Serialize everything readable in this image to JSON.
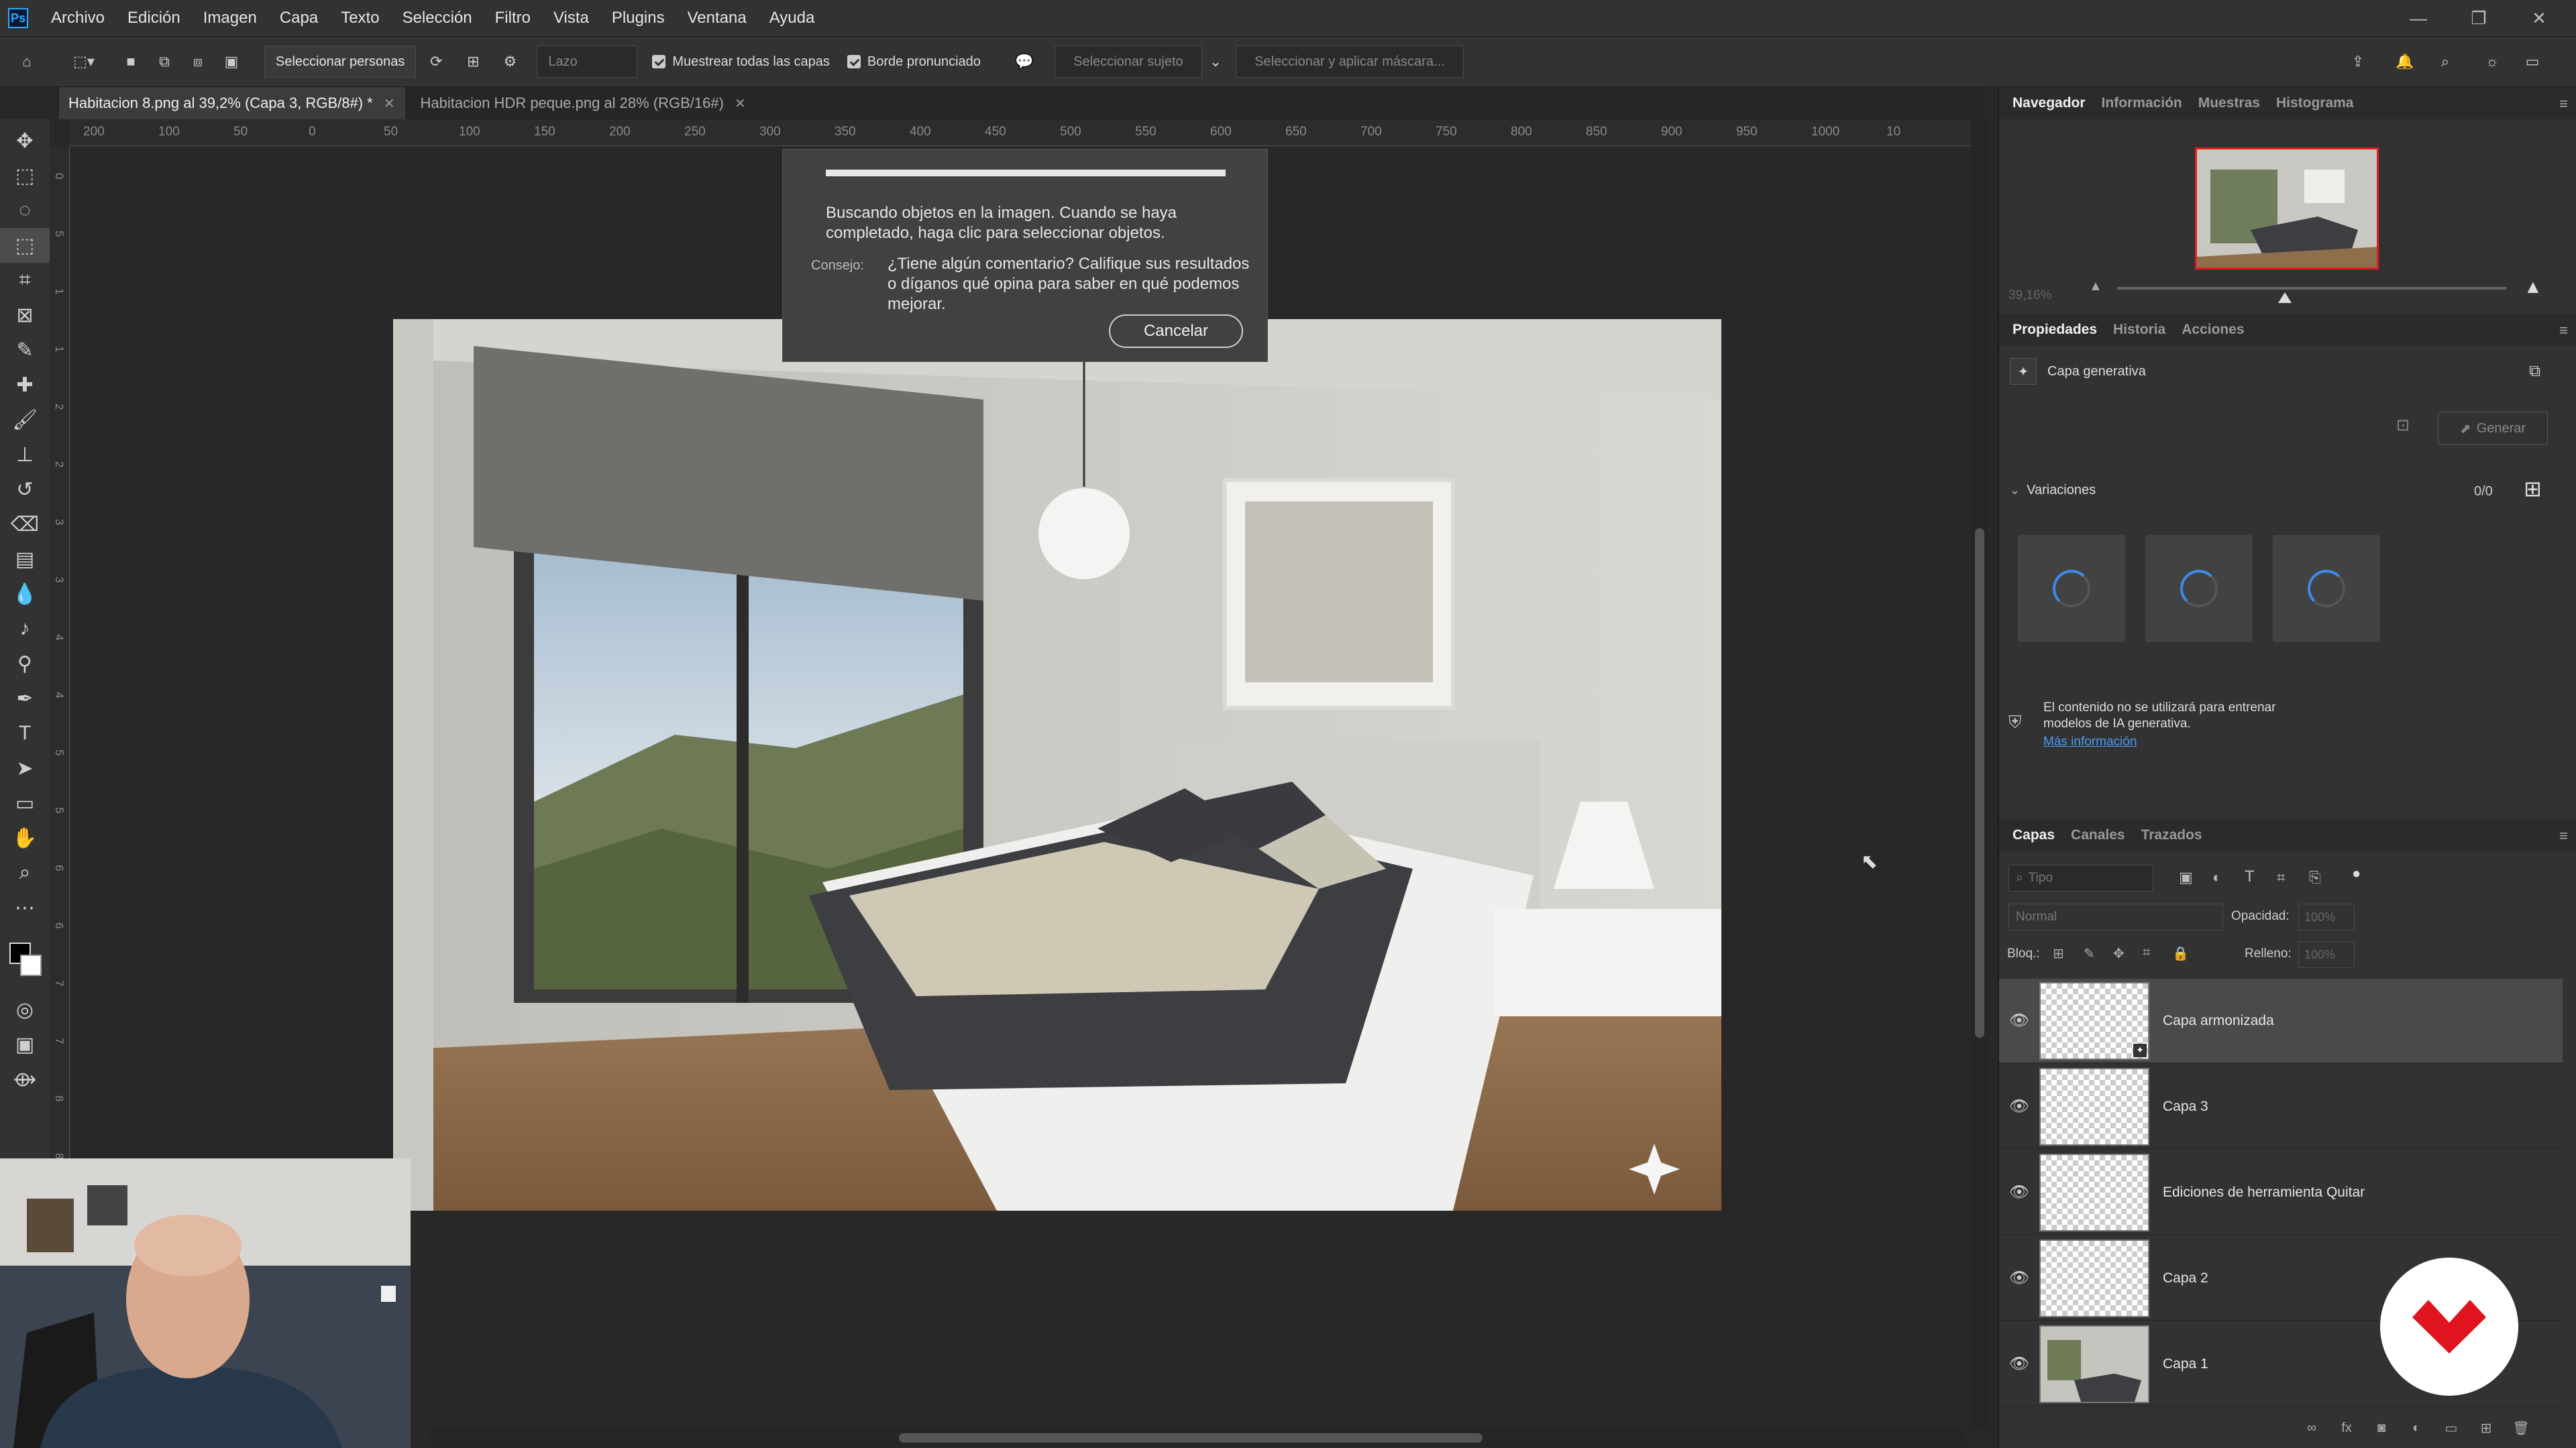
{
  "app": {
    "logo": "Ps"
  },
  "menu": [
    "Archivo",
    "Edición",
    "Imagen",
    "Capa",
    "Texto",
    "Selección",
    "Filtro",
    "Vista",
    "Plugins",
    "Ventana",
    "Ayuda"
  ],
  "options": {
    "select_people": "Seleccionar personas",
    "mode": "Lazo",
    "sample_all": "Muestrear todas las capas",
    "hard_edge": "Borde pronunciado",
    "select_subject": "Seleccionar sujeto",
    "select_mask": "Seleccionar y aplicar máscara..."
  },
  "tabs": [
    {
      "label": "Habitacion 8.png al 39,2% (Capa 3, RGB/8#) *",
      "active": true
    },
    {
      "label": "Habitacion HDR peque.png al 28% (RGB/16#)",
      "active": false
    }
  ],
  "ruler_top": [
    "200",
    "100",
    "50",
    "0",
    "50",
    "100",
    "150",
    "200",
    "250",
    "300",
    "350",
    "400",
    "450",
    "500",
    "550",
    "600",
    "650",
    "700",
    "750",
    "800",
    "850",
    "900",
    "950",
    "1000",
    "10"
  ],
  "ruler_left": [
    "0",
    "5",
    "1",
    "1",
    "2",
    "2",
    "3",
    "3",
    "4",
    "4",
    "5",
    "5",
    "6",
    "6",
    "7",
    "7",
    "8",
    "8",
    "9",
    "9",
    "1",
    "1"
  ],
  "dialog": {
    "progress": 1.0,
    "message": "Buscando objetos en la imagen. Cuando se haya completado, haga clic para seleccionar objetos.",
    "tip_label": "Consejo:",
    "tip": "¿Tiene algún comentario? Califique sus resultados o díganos qué opina para saber en qué podemos mejorar.",
    "cancel": "Cancelar"
  },
  "navigator": {
    "tabs": [
      "Navegador",
      "Información",
      "Muestras",
      "Histograma"
    ],
    "zoom": "39,16%"
  },
  "properties": {
    "tabs": [
      "Propiedades",
      "Historia",
      "Acciones"
    ],
    "layer_type": "Capa generativa",
    "generate": "Generar",
    "variations_label": "Variaciones",
    "variations_count": "0/0",
    "notice": "El contenido no se utilizará para entrenar modelos de IA generativa.",
    "more_info": "Más información"
  },
  "layers": {
    "tabs": [
      "Capas",
      "Canales",
      "Trazados"
    ],
    "filter_placeholder": "Tipo",
    "blend_mode": "Normal",
    "opacity_label": "Opacidad:",
    "opacity": "100%",
    "lock_label": "Bloq.:",
    "fill_label": "Relleno:",
    "fill": "100%",
    "items": [
      {
        "name": "Capa armonizada",
        "selected": true
      },
      {
        "name": "Capa 3",
        "selected": false
      },
      {
        "name": "Ediciones de herramienta Quitar",
        "selected": false
      },
      {
        "name": "Capa 2",
        "selected": false
      },
      {
        "name": "Capa 1",
        "selected": false
      }
    ]
  },
  "colors": {
    "accent": "#31a8ff",
    "brand_red": "#e0141e"
  }
}
